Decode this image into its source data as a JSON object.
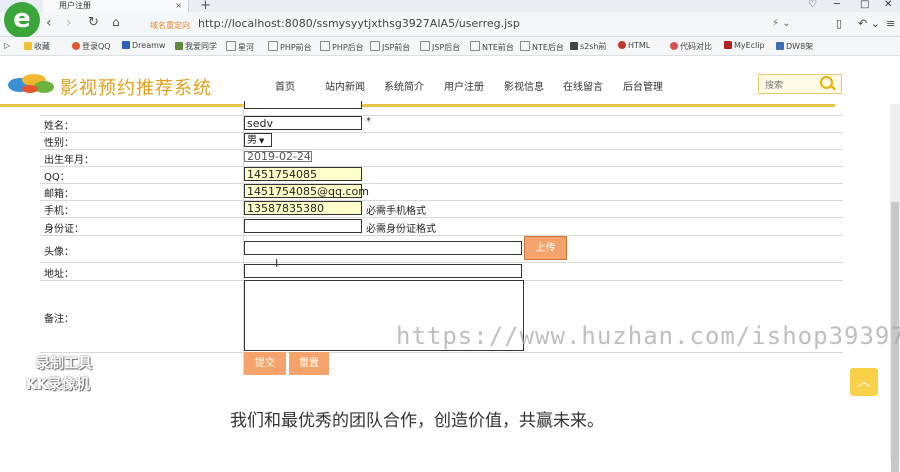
{
  "browser": {
    "tab_title": "用户注册",
    "domain_hint": "域名重定向",
    "url": "http://localhost:8080/ssmysyytjxthsg3927AIA5/userreg.jsp",
    "bookmarks": [
      "收藏",
      "登录QQ",
      "Dreamw",
      "我爱同学",
      "星河",
      "PHP前台",
      "PHP后台",
      "JSP前台",
      "JSP后台",
      "NTE前台",
      "NTE后台",
      "s2sh前",
      "HTML",
      "代码对比",
      "MyEclip",
      "DW8架"
    ]
  },
  "site": {
    "title": "影视预约推荐系统",
    "nav": [
      "首页",
      "站内新闻",
      "系统简介",
      "用户注册",
      "影视信息",
      "在线留言",
      "后台管理"
    ],
    "search_placeholder": "搜索"
  },
  "form": {
    "labels": {
      "name": "姓名：",
      "gender": "性别：",
      "birth": "出生年月：",
      "qq": "QQ：",
      "email": "邮箱：",
      "phone": "手机：",
      "idcard": "身份证：",
      "avatar": "头像：",
      "address": "地址：",
      "remark": "备注："
    },
    "values": {
      "name": "sedv",
      "gender": "男",
      "birth": "2019-02-24",
      "qq": "1451754085",
      "email": "1451754085@qq.com",
      "phone": "13587835380",
      "idcard": "",
      "avatar": "",
      "address": "",
      "remark": ""
    },
    "required_mark": "*",
    "phone_hint": "必需手机格式",
    "idcard_hint": "必需身份证格式",
    "upload_label": "上传",
    "submit_label": "提交",
    "reset_label": "重置"
  },
  "watermark": "https://www.huzhan.com/ishop39397",
  "recorder": [
    "录制工具",
    "KK录像机"
  ],
  "slogan": "我们和最优秀的团队合作，创造价值，共赢未来。",
  "colors": {
    "accent": "#e0a21c",
    "button": "#f4a46a",
    "highlight_field": "#ffffcc"
  }
}
